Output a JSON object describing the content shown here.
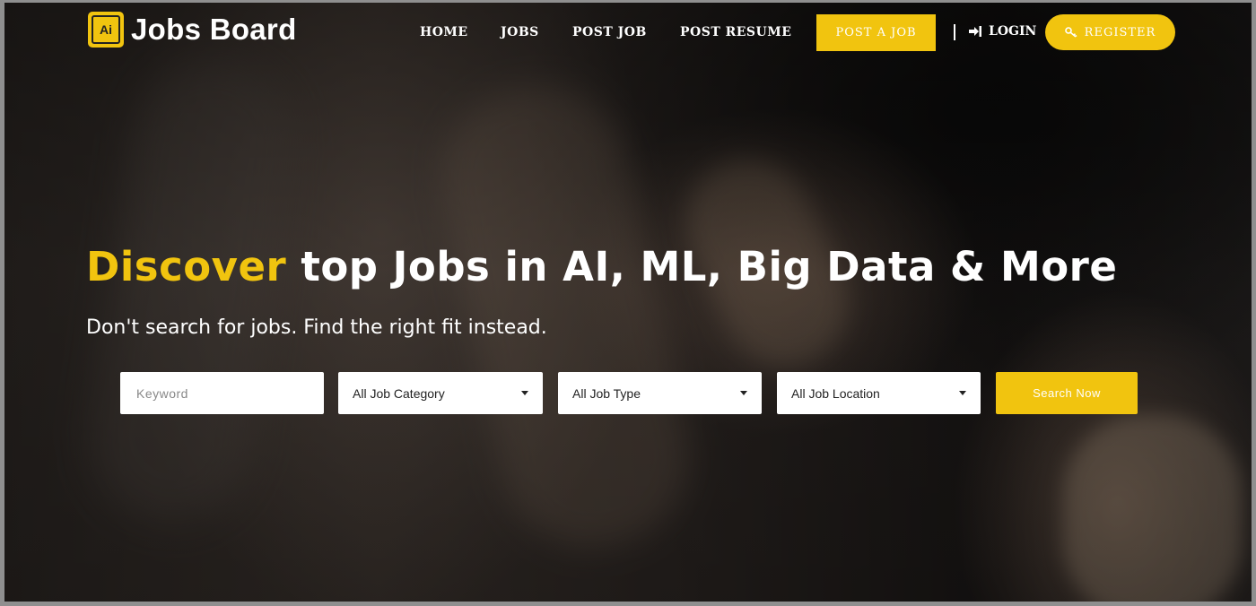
{
  "header": {
    "logo_chip": "Ai",
    "logo_text": "Jobs Board",
    "nav": [
      "HOME",
      "JOBS",
      "POST JOB",
      "POST RESUME"
    ],
    "post_job_button": "POST A JOB",
    "login_label": "LOGIN",
    "register_label": "REGISTER"
  },
  "hero": {
    "title_accent": "Discover",
    "title_rest": " top Jobs in AI, ML, Big Data & More",
    "subtitle": "Don't search for jobs. Find the right fit instead."
  },
  "search": {
    "keyword_placeholder": "Keyword",
    "category": "All Job Category",
    "type": "All Job Type",
    "location": "All Job Location",
    "submit_label": "Search Now"
  },
  "icons": {
    "login": "login-arrow-icon",
    "register": "key-icon",
    "dropdown": "caret-down-icon"
  },
  "colors": {
    "accent": "#f1c40f",
    "text_light": "#ffffff"
  }
}
